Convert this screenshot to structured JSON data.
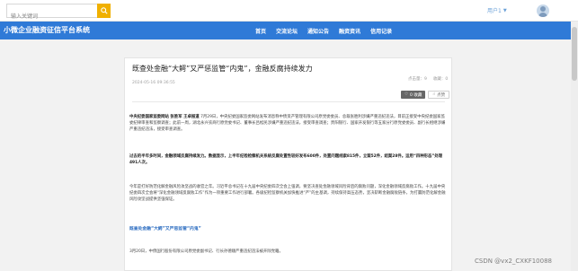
{
  "topbar": {
    "search_placeholder": "输入关键词",
    "username": "用户1"
  },
  "navbar": {
    "brand": "小微企业融资征信平台系统",
    "items": [
      "首页",
      "交流论坛",
      "通知公告",
      "融资资讯",
      "信用记录"
    ]
  },
  "article": {
    "title": "既查处金融“大鳄”又严惩监管“内鬼”，金融反腐持续发力",
    "meta_views_label": "点击量：9",
    "meta_favs_label": "收藏：0",
    "date": "2024-05-16 09:36:55",
    "like_button": "0 收藏",
    "fav_button": "点赞",
    "para1_lead": "中央纪委国家监委网站 张胜军 王卓报道",
    "para1_body": "7月29日，中央纪委国家监委网站发布消息称中债资产管理有限公司原党委委员、总裁张胜利涉嫌严重违纪违法，目前正接受中央纪委国家监委纪律审查和监察调查；此前一周，湖北永兴农商行原党委书记、董事长吕松民涉嫌严重违纪违法，接受审查调查；贵阳银行、国家开发银行等五家分行原党委委员、副行长相继涉嫌严重违纪违法，接受审查调查。",
    "para2": "过去的半年多时间，金融领域反腐持续发力。数据显示，上半年纪检检察机关系统反腐处置性较好发布600件，处置问题线索815件，立案52件，结案28件。运用“四种形态”处理491人次。",
    "para3": "今年是打好防范化解金融风险攻坚战的收官之年。习近平总书记在十九届中央纪委四次全会上强调，要坚决查处金融领域风险背后的腐败问题，深化金融领域反腐败工作。十九届中央纪委四次全会将“深化金融领域反腐败工作”作为一项重要工作进行部署。各级纪检监察机关加快推进“严”的主基调，持续保持高压态势，坚决斩断金融腐败链条，为打赢防范化解金融风险攻坚战提供坚强保证。",
    "link": "既查处金融“大鳄”又严惩监管“内鬼”",
    "para4": "3月20日，中债国行股份有限公司原党委副书记、行长孙德顺严重违纪违法被开除党籍。"
  },
  "watermark": "CSDN @vx2_CXKF10088"
}
